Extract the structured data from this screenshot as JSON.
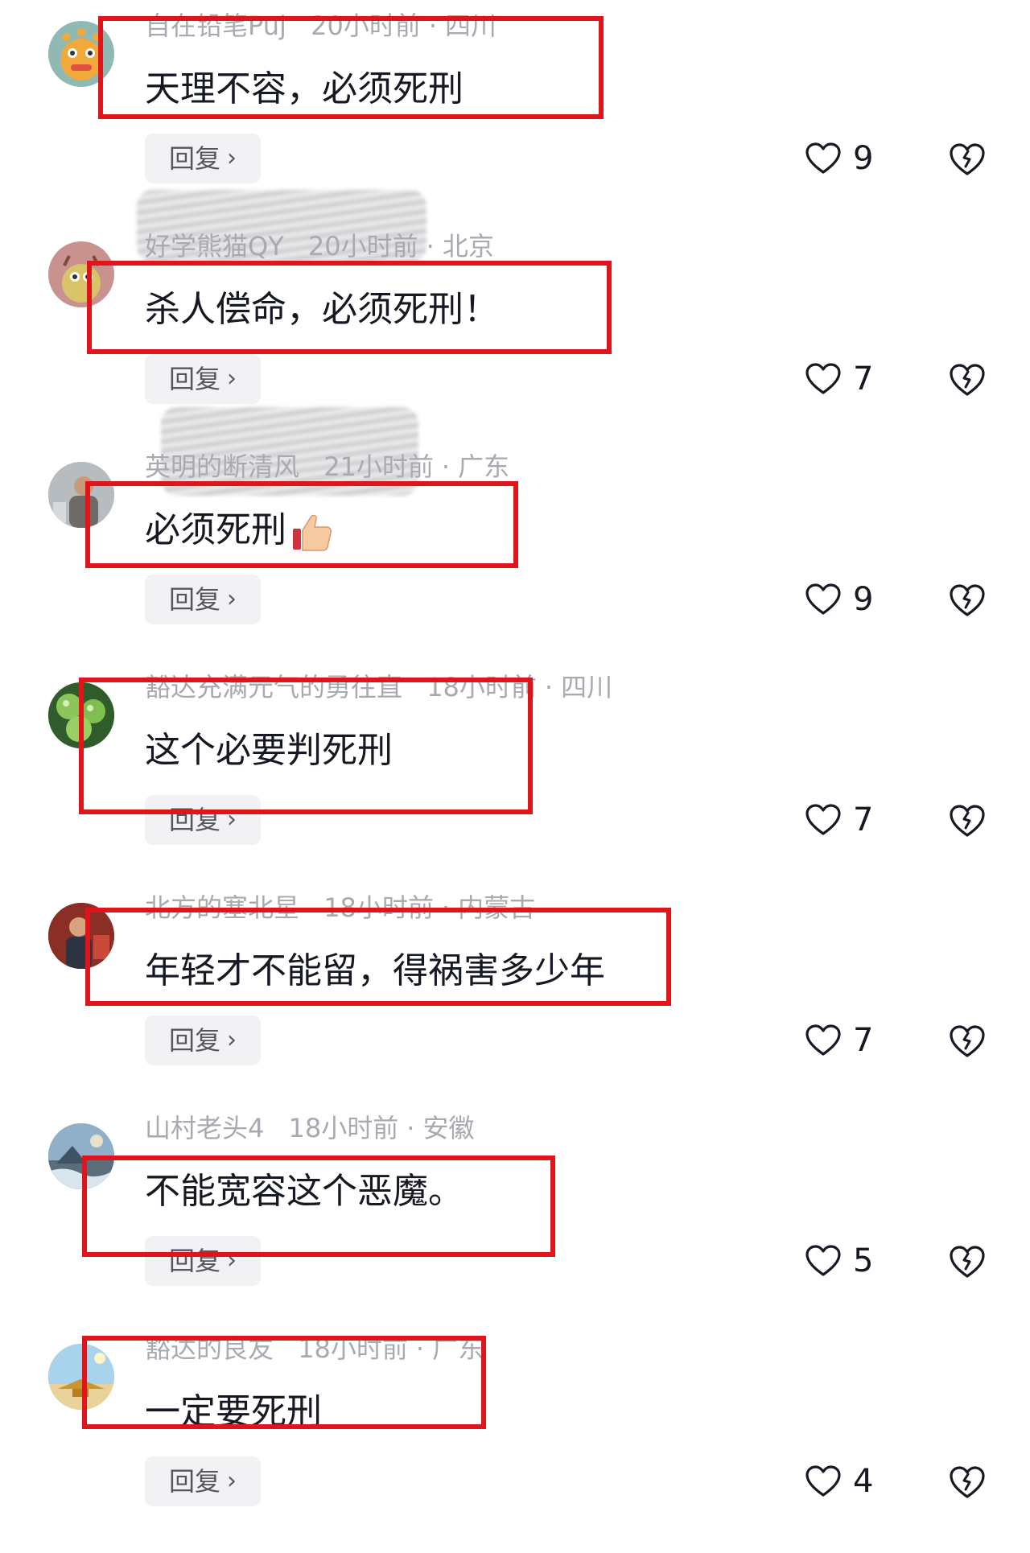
{
  "colors": {
    "background": "#ffffff",
    "text": "#161823",
    "meta_text": "#a8aab1",
    "reply_bg": "#f2f2f4",
    "highlight_border": "#e1141b"
  },
  "icons": {
    "like": "heart-outline-icon",
    "dislike": "broken-heart-icon",
    "reply_chevron": "chevron-right-icon"
  },
  "comments": [
    {
      "username": "自在铅笔Puj",
      "time": "20小时前",
      "location": "四川",
      "text": "天理不容，必须死刑",
      "emoji": "",
      "reply_label": "回复",
      "likes": "9"
    },
    {
      "username": "好学熊猫QY",
      "time": "20小时前",
      "location": "北京",
      "text": "杀人偿命，必须死刑！",
      "emoji": "",
      "reply_label": "回复",
      "likes": "7"
    },
    {
      "username": "英明的断清风",
      "time": "21小时前",
      "location": "广东",
      "text": "必须死刑",
      "emoji": "thumbs-up-emoji",
      "reply_label": "回复",
      "likes": "9"
    },
    {
      "username": "豁达充满元气的勇往直",
      "time": "18小时前",
      "location": "四川",
      "text": "这个必要判死刑",
      "emoji": "",
      "reply_label": "回复",
      "likes": "7"
    },
    {
      "username": "北方的塞北星",
      "time": "18小时前",
      "location": "内蒙古",
      "text": "年轻才不能留，得祸害多少年",
      "emoji": "",
      "reply_label": "回复",
      "likes": "7"
    },
    {
      "username": "山村老头4",
      "time": "18小时前",
      "location": "安徽",
      "text": "不能宽容这个恶魔。",
      "emoji": "",
      "reply_label": "回复",
      "likes": "5"
    },
    {
      "username": "豁达的良友",
      "time": "18小时前",
      "location": "广东",
      "text": "一定要死刑",
      "emoji": "",
      "reply_label": "回复",
      "likes": "4"
    }
  ]
}
